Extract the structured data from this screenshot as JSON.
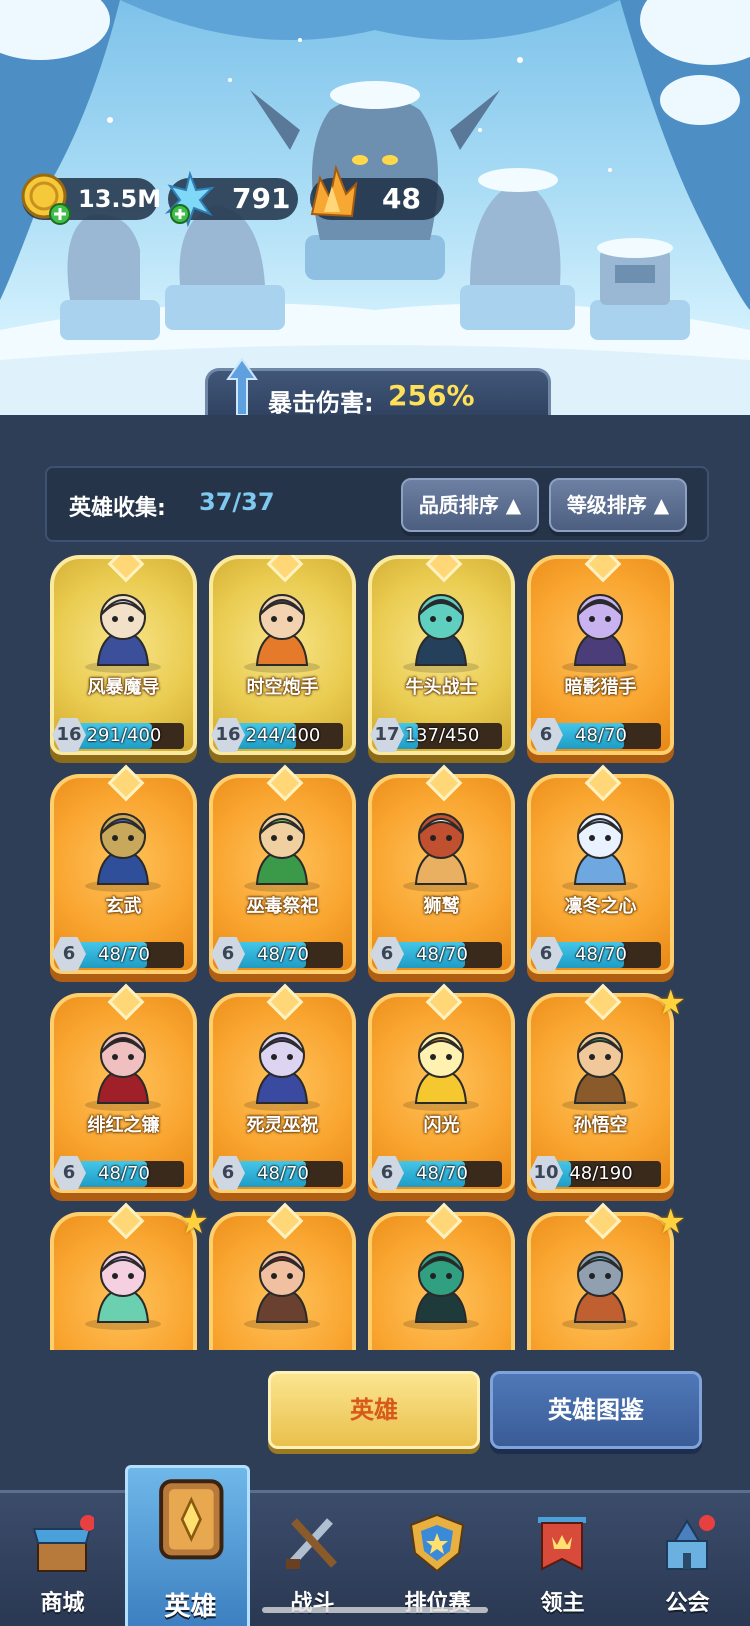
{
  "resources": {
    "gold": "13.5M",
    "crystal": "791",
    "amber": "48"
  },
  "crit_damage": {
    "label": "暴击伤害:",
    "value": "256%"
  },
  "collection": {
    "label": "英雄收集:",
    "value": "37/37",
    "sort_quality": "品质排序",
    "sort_level": "等级排序"
  },
  "heroes": [
    {
      "name": "风暴魔导",
      "level": "16",
      "progress": "291/400",
      "fill": 0.73,
      "tier": "gold",
      "star": false
    },
    {
      "name": "时空炮手",
      "level": "16",
      "progress": "244/400",
      "fill": 0.61,
      "tier": "gold",
      "star": false
    },
    {
      "name": "牛头战士",
      "level": "17",
      "progress": "137/450",
      "fill": 0.3,
      "tier": "gold",
      "star": false
    },
    {
      "name": "暗影猎手",
      "level": "6",
      "progress": "48/70",
      "fill": 0.69,
      "tier": "orange",
      "star": false
    },
    {
      "name": "玄武",
      "level": "6",
      "progress": "48/70",
      "fill": 0.69,
      "tier": "orange",
      "star": false
    },
    {
      "name": "巫毒祭祀",
      "level": "6",
      "progress": "48/70",
      "fill": 0.69,
      "tier": "orange",
      "star": false
    },
    {
      "name": "狮鹫",
      "level": "6",
      "progress": "48/70",
      "fill": 0.69,
      "tier": "orange",
      "star": false
    },
    {
      "name": "凛冬之心",
      "level": "6",
      "progress": "48/70",
      "fill": 0.69,
      "tier": "orange",
      "star": false
    },
    {
      "name": "绯红之镰",
      "level": "6",
      "progress": "48/70",
      "fill": 0.69,
      "tier": "orange",
      "star": false
    },
    {
      "name": "死灵巫祝",
      "level": "6",
      "progress": "48/70",
      "fill": 0.69,
      "tier": "orange",
      "star": false
    },
    {
      "name": "闪光",
      "level": "6",
      "progress": "48/70",
      "fill": 0.69,
      "tier": "orange",
      "star": false
    },
    {
      "name": "孙悟空",
      "level": "10",
      "progress": "48/190",
      "fill": 0.25,
      "tier": "orange",
      "star": true
    },
    {
      "name": "",
      "level": "",
      "progress": "",
      "fill": 0,
      "tier": "orange",
      "star": true
    },
    {
      "name": "",
      "level": "",
      "progress": "",
      "fill": 0,
      "tier": "orange",
      "star": false
    },
    {
      "name": "",
      "level": "",
      "progress": "",
      "fill": 0,
      "tier": "orange",
      "star": false
    },
    {
      "name": "",
      "level": "",
      "progress": "",
      "fill": 0,
      "tier": "orange",
      "star": true
    }
  ],
  "buttons": {
    "heroes": "英雄",
    "codex": "英雄图鉴"
  },
  "nav": [
    {
      "label": "商城",
      "icon": "shop-icon"
    },
    {
      "label": "英雄",
      "icon": "hero-card-icon"
    },
    {
      "label": "战斗",
      "icon": "crossed-weapons-icon"
    },
    {
      "label": "排位赛",
      "icon": "ranking-shield-icon"
    },
    {
      "label": "领主",
      "icon": "banner-icon"
    },
    {
      "label": "公会",
      "icon": "castle-icon"
    }
  ],
  "colors": {
    "accent_gold": "#ffe05a",
    "collection_value": "#7fc8f0",
    "panel_bg": "#2e3e57"
  }
}
